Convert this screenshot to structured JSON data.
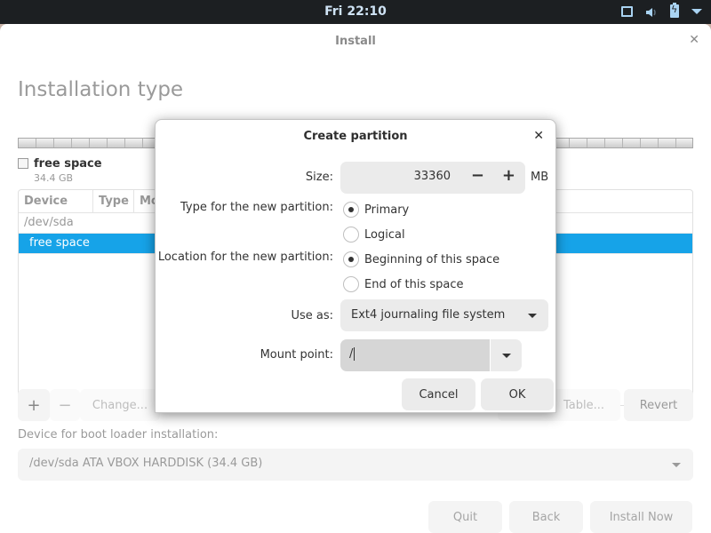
{
  "topbar": {
    "clock": "Fri 22:10",
    "tray_icons": [
      "screen-icon",
      "volume-icon",
      "battery-charging-icon",
      "system-menu-icon"
    ]
  },
  "window": {
    "title": "Install",
    "close_glyph": "✕"
  },
  "page": {
    "title": "Installation type"
  },
  "disk_legend": {
    "name": "free space",
    "size": "34.4 GB"
  },
  "partition_table": {
    "columns": [
      "Device",
      "Type",
      "Mo"
    ],
    "rows": [
      {
        "device": "/dev/sda",
        "selected": false
      },
      {
        "device": "free space",
        "selected": true
      }
    ]
  },
  "toolbar": {
    "add_glyph": "+",
    "remove_glyph": "−",
    "change_label": "Change...",
    "new_table_label": "New Partition Table...",
    "new_table_visible": "Table...",
    "revert_label": "Revert"
  },
  "bootloader": {
    "label": "Device for boot loader installation:",
    "selected": "/dev/sda ATA VBOX HARDDISK (34.4 GB)"
  },
  "nav": {
    "quit_label": "Quit",
    "back_label": "Back",
    "install_label": "Install Now"
  },
  "dialog": {
    "title": "Create partition",
    "close_glyph": "✕",
    "size_label": "Size:",
    "size_value": "33360",
    "size_unit": "MB",
    "minus_glyph": "−",
    "plus_glyph": "+",
    "type_label": "Type for the new partition:",
    "type_options": [
      {
        "label": "Primary",
        "checked": true
      },
      {
        "label": "Logical",
        "checked": false
      }
    ],
    "location_label": "Location for the new partition:",
    "location_options": [
      {
        "label": "Beginning of this space",
        "checked": true
      },
      {
        "label": "End of this space",
        "checked": false
      }
    ],
    "use_as_label": "Use as:",
    "use_as_value": "Ext4 journaling file system",
    "mount_label": "Mount point:",
    "mount_value": "/",
    "cancel_label": "Cancel",
    "ok_label": "OK"
  }
}
